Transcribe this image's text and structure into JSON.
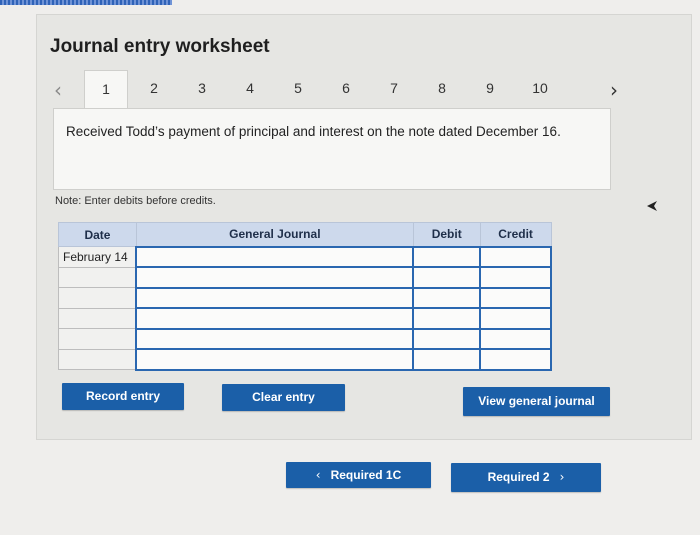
{
  "page": {
    "title": "Journal entry worksheet"
  },
  "tabs": {
    "prev_icon": "chevron-left-icon",
    "next_icon": "chevron-right-icon",
    "items": [
      "1",
      "2",
      "3",
      "4",
      "5",
      "6",
      "7",
      "8",
      "9",
      "10"
    ],
    "active": "1"
  },
  "description": "Received Todd’s payment of principal and interest on the note dated December 16.",
  "note": "Note: Enter debits before credits.",
  "table": {
    "headers": {
      "date": "Date",
      "general_journal": "General Journal",
      "debit": "Debit",
      "credit": "Credit"
    },
    "rows": [
      {
        "date": "February 14",
        "account": "",
        "debit": "",
        "credit": ""
      },
      {
        "date": "",
        "account": "",
        "debit": "",
        "credit": ""
      },
      {
        "date": "",
        "account": "",
        "debit": "",
        "credit": ""
      },
      {
        "date": "",
        "account": "",
        "debit": "",
        "credit": ""
      },
      {
        "date": "",
        "account": "",
        "debit": "",
        "credit": ""
      },
      {
        "date": "",
        "account": "",
        "debit": "",
        "credit": ""
      }
    ]
  },
  "buttons": {
    "record_entry": "Record entry",
    "clear_entry": "Clear entry",
    "view_general_journal": "View general journal",
    "required_prev": "Required 1C",
    "required_next": "Required 2"
  },
  "colors": {
    "button_blue": "#1b5fa8",
    "header_bg": "#cdd9ec",
    "input_border": "#2a67b0"
  }
}
